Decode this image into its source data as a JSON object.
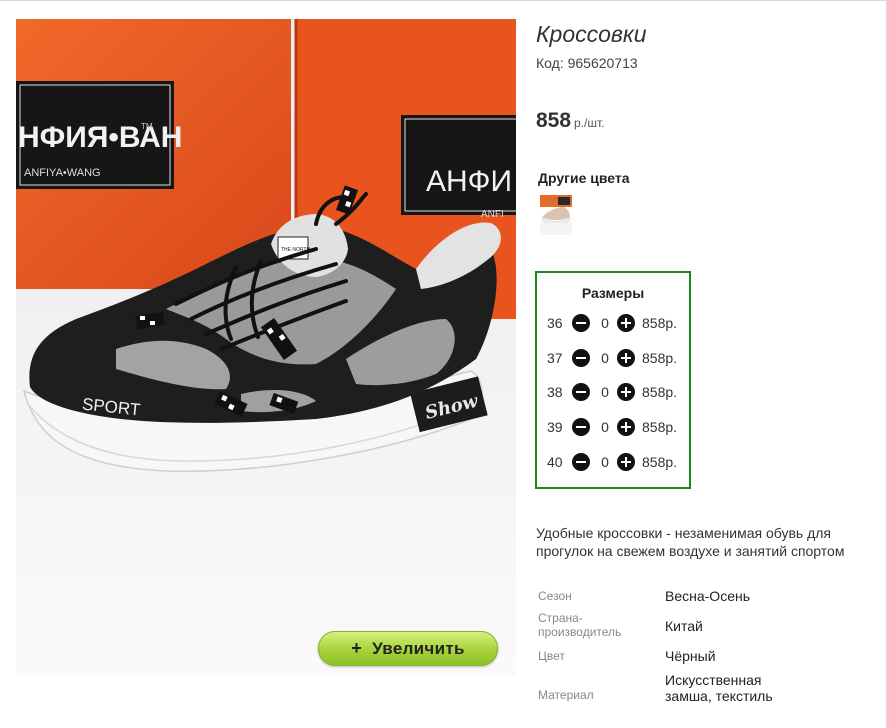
{
  "product": {
    "title": "Кроссовки",
    "code_label": "Код: 965620713",
    "price": "858",
    "price_unit": "р./шт.",
    "zoom_label": "Увеличить",
    "zoom_plus": "+"
  },
  "photo": {
    "box_brand_left": "НФИЯ•ВАН",
    "box_tm": "TM",
    "box_sub_left": "ANFIYA•WANG",
    "box_brand_right": "АНФИ",
    "box_sub_right": "ANFI",
    "shoe_side_text": "SPORT",
    "shoe_heel_text": "Show",
    "tongue_text": "THE NORTH"
  },
  "other_colors": {
    "title": "Другие цвета"
  },
  "sizes": {
    "title": "Размеры",
    "rows": [
      {
        "size": "36",
        "qty": "0",
        "price": "858р."
      },
      {
        "size": "37",
        "qty": "0",
        "price": "858р."
      },
      {
        "size": "38",
        "qty": "0",
        "price": "858р."
      },
      {
        "size": "39",
        "qty": "0",
        "price": "858р."
      },
      {
        "size": "40",
        "qty": "0",
        "price": "858р."
      }
    ]
  },
  "description": "Удобные кроссовки - незаменимая обувь для прогулок на свежем воздухе и занятий спортом",
  "attributes": [
    {
      "label": "Сезон",
      "value": "Весна-Осень"
    },
    {
      "label": "Страна-производитель",
      "value": "Китай"
    },
    {
      "label": "Цвет",
      "value": "Чёрный"
    },
    {
      "label": "Материал",
      "value": "Искусственная замша, текстиль"
    }
  ],
  "colors": {
    "accent_green": "#1a8a1a",
    "zoom_button": "#a6d23a",
    "box_orange": "#e8521c"
  }
}
